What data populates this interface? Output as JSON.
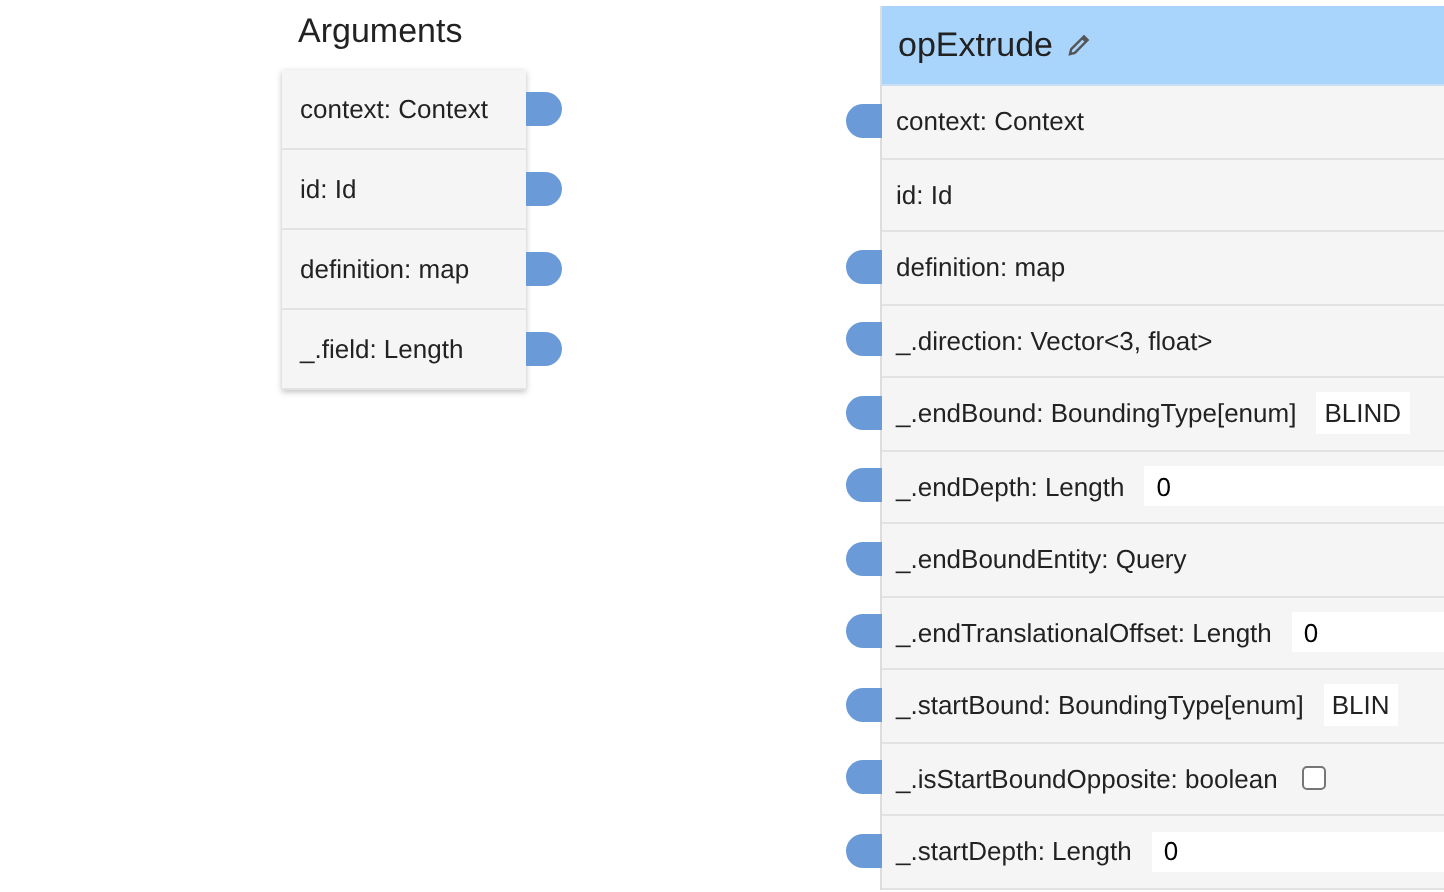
{
  "arguments_node": {
    "title": "Arguments",
    "rows": [
      {
        "label": "context: Context"
      },
      {
        "label": "id: Id"
      },
      {
        "label": "definition: map"
      },
      {
        "label": "_.field: Length"
      }
    ]
  },
  "op_node": {
    "title": "opExtrude",
    "rows": [
      {
        "kind": "plain",
        "label": "context: Context",
        "has_port": true
      },
      {
        "kind": "plain",
        "label": "id: Id",
        "has_port": false
      },
      {
        "kind": "plain",
        "label": "definition: map",
        "has_port": true
      },
      {
        "kind": "plain",
        "label": "_.direction: Vector<3, float>",
        "has_port": true
      },
      {
        "kind": "select",
        "label": "_.endBound: BoundingType[enum]",
        "has_port": true,
        "value": "BLIND"
      },
      {
        "kind": "input",
        "label": "_.endDepth: Length",
        "has_port": true,
        "value": "0"
      },
      {
        "kind": "plain",
        "label": "_.endBoundEntity: Query",
        "has_port": true
      },
      {
        "kind": "input",
        "label": "_.endTranslationalOffset: Length",
        "has_port": true,
        "value": "0"
      },
      {
        "kind": "select",
        "label": "_.startBound: BoundingType[enum]",
        "has_port": true,
        "value": "BLIN"
      },
      {
        "kind": "checkbox",
        "label": "_.isStartBoundOpposite: boolean",
        "has_port": true,
        "checked": false
      },
      {
        "kind": "input",
        "label": "_.startDepth: Length",
        "has_port": true,
        "value": "0"
      }
    ]
  }
}
